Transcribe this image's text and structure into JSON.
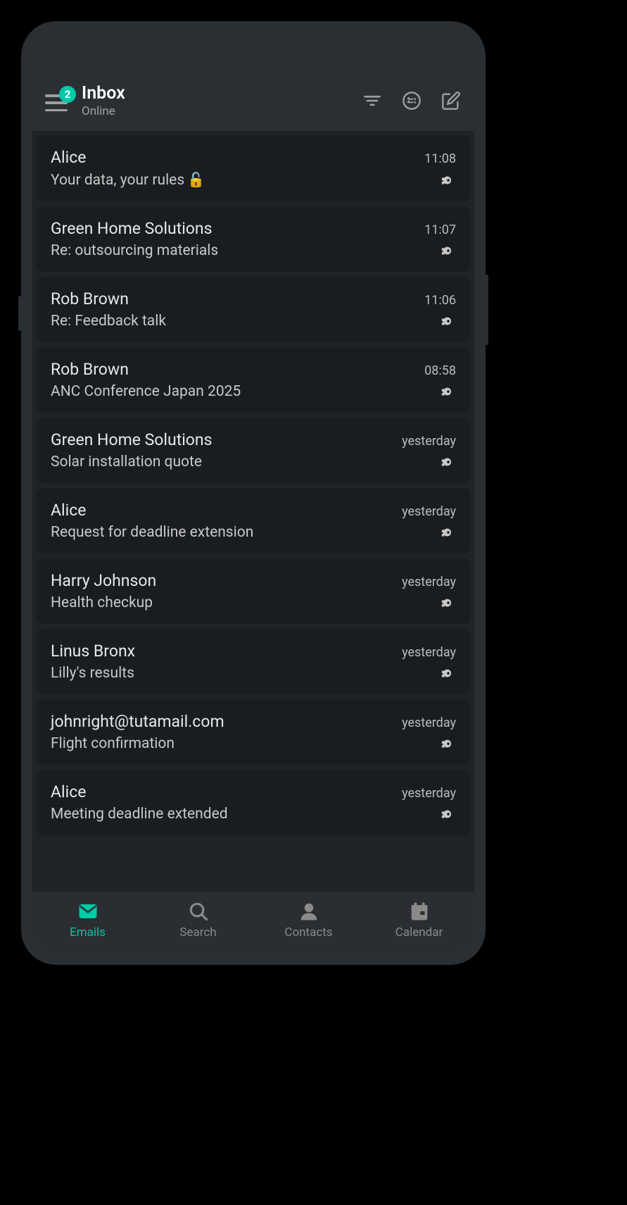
{
  "header": {
    "badge": "2",
    "title": "Inbox",
    "subtitle": "Online"
  },
  "emails": [
    {
      "sender": "Alice",
      "subject": "Your data, your rules",
      "time": "11:08",
      "lock_emoji": "🔓"
    },
    {
      "sender": "Green Home Solutions",
      "subject": "Re: outsourcing materials",
      "time": "11:07"
    },
    {
      "sender": "Rob Brown",
      "subject": "Re: Feedback talk",
      "time": "11:06"
    },
    {
      "sender": "Rob Brown",
      "subject": "ANC Conference Japan 2025",
      "time": "08:58"
    },
    {
      "sender": "Green Home Solutions",
      "subject": "Solar installation quote",
      "time": "yesterday"
    },
    {
      "sender": "Alice",
      "subject": "Request for deadline extension",
      "time": "yesterday"
    },
    {
      "sender": "Harry Johnson",
      "subject": "Health checkup",
      "time": "yesterday"
    },
    {
      "sender": "Linus Bronx",
      "subject": "Lilly's results",
      "time": "yesterday"
    },
    {
      "sender": "johnright@tutamail.com",
      "subject": "Flight confirmation",
      "time": "yesterday"
    },
    {
      "sender": "Alice",
      "subject": "Meeting deadline extended",
      "time": "yesterday"
    }
  ],
  "nav": {
    "emails": "Emails",
    "search": "Search",
    "contacts": "Contacts",
    "calendar": "Calendar"
  }
}
